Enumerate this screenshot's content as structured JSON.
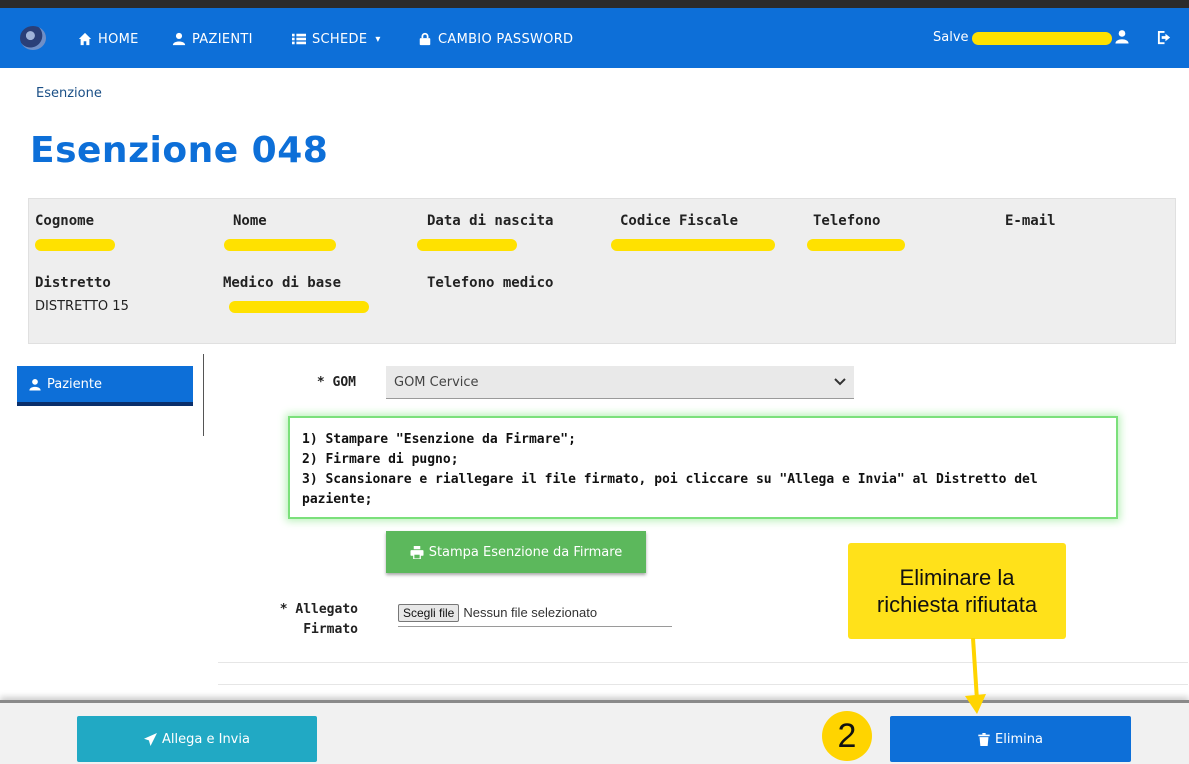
{
  "nav": {
    "home": "HOME",
    "pazienti": "PAZIENTI",
    "schede": "SCHEDE",
    "password": "CAMBIO PASSWORD",
    "greeting": "Salve"
  },
  "breadcrumb": "Esenzione",
  "title": "Esenzione 048",
  "patient": {
    "cognome_label": "Cognome",
    "nome_label": "Nome",
    "nascita_label": "Data di nascita",
    "cf_label": "Codice Fiscale",
    "telefono_label": "Telefono",
    "email_label": "E-mail",
    "distretto_label": "Distretto",
    "distretto_value": "DISTRETTO 15",
    "medico_label": "Medico di base",
    "telmedico_label": "Telefono medico"
  },
  "sidebar": {
    "paziente": "Paziente"
  },
  "form": {
    "gom_label": "* GOM",
    "gom_value": "GOM Cervice",
    "instructions": [
      "1) Stampare \"Esenzione da Firmare\";",
      "2) Firmare di pugno;",
      "3) Scansionare e riallegare il file firmato, poi cliccare su \"Allega e Invia\" al Distretto del paziente;"
    ],
    "print_button": "Stampa Esenzione da Firmare",
    "allegato_label_1": "* Allegato",
    "allegato_label_2": "Firmato",
    "file_button": "Scegli file",
    "file_status": "Nessun file selezionato"
  },
  "footer": {
    "send_button": "Allega e Invia",
    "delete_button": "Elimina"
  },
  "annotation": {
    "step": "2",
    "callout": "Eliminare la richiesta rifiutata"
  },
  "colors": {
    "primary": "#0d6fd8",
    "success": "#5cb85c",
    "info": "#21a9c4",
    "highlight": "#ffe100"
  }
}
